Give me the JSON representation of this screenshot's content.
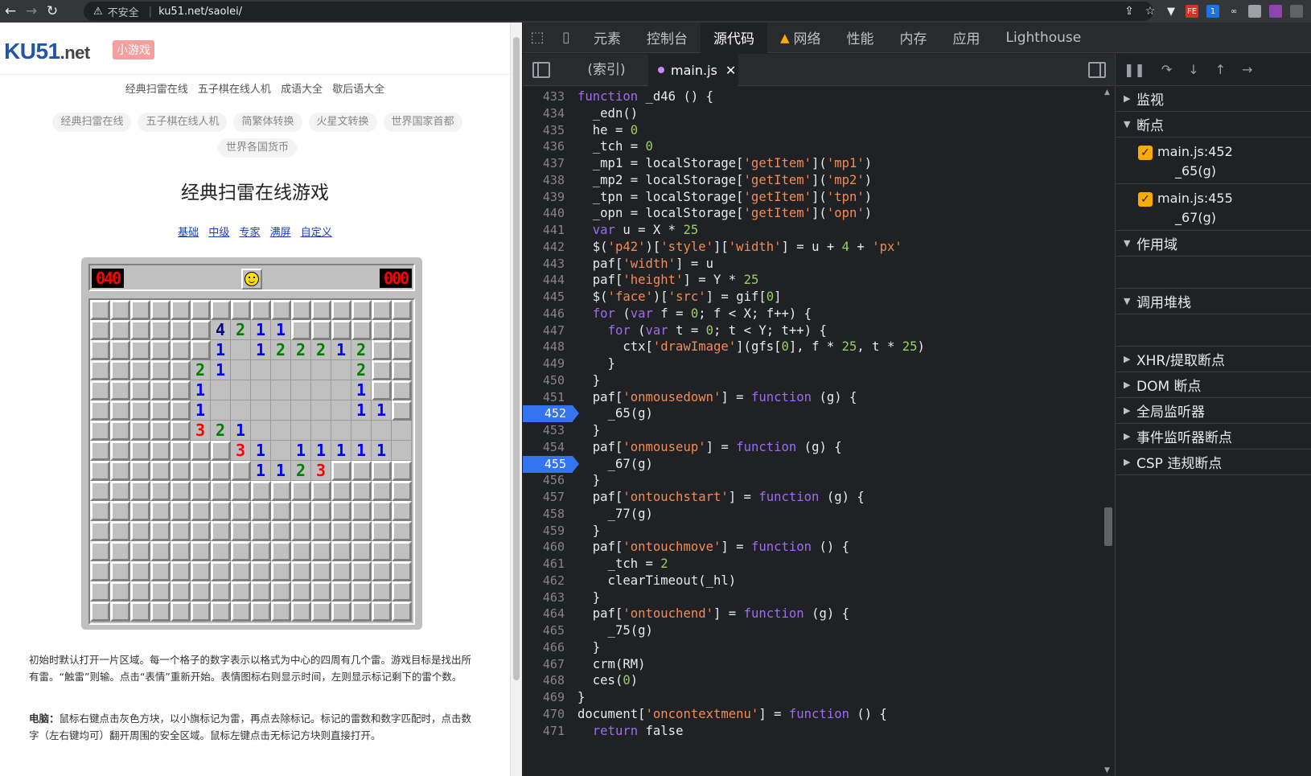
{
  "browser": {
    "security": "不安全",
    "url": "ku51.net/saolei/"
  },
  "site": {
    "logo_main": "KU51",
    "logo_net": ".net",
    "logo_badge": "小游戏",
    "top_links": [
      "经典扫雷在线",
      "五子棋在线人机",
      "成语大全",
      "歇后语大全"
    ],
    "pills": [
      "经典扫雷在线",
      "五子棋在线人机",
      "简繁体转换",
      "火星文转换",
      "世界国家首都",
      "世界各国货币"
    ],
    "title": "经典扫雷在线游戏",
    "levels": [
      "基础",
      "中级",
      "专家",
      "满屏",
      "自定义"
    ],
    "mine_counter": "040",
    "timer": "000",
    "grid": [
      "################",
      "######4211######",
      "######1 122212##",
      "#####21      2##",
      "#####1       1##",
      "#####1       11#",
      "#####321        ",
      "#######31 11111 ",
      "########1123####",
      "################",
      "################",
      "################",
      "################",
      "################",
      "################",
      "################"
    ],
    "desc1": "初始时默认打开一片区域。每一个格子的数字表示以格式为中心的四周有几个雷。游戏目标是找出所有雷。“触雷”则输。点击“表情”重新开始。表情图标右则显示时间，左则显示标记剩下的雷个数。",
    "desc2_label": "电脑：",
    "desc2": "鼠标右键点击灰色方块，以小旗标记为雷，再点去除标记。标记的雷数和数字匹配时，点击数字（左右键均可）翻开周围的安全区域。鼠标左键点击无标记方块则直接打开。"
  },
  "devtools": {
    "tabs": [
      "元素",
      "控制台",
      "源代码",
      "网络",
      "性能",
      "内存",
      "应用",
      "Lighthouse"
    ],
    "active_tab": "源代码",
    "file_tab_index": "(索引)",
    "file_tab_main": "main.js",
    "code_lines": [
      {
        "n": "433",
        "html": "<span class='kw'>function</span> _d46 () {"
      },
      {
        "n": "434",
        "html": "  _edn()"
      },
      {
        "n": "435",
        "html": "  he = <span class='num'>0</span>"
      },
      {
        "n": "436",
        "html": "  _tch = <span class='num'>0</span>"
      },
      {
        "n": "437",
        "html": "  _mp1 = localStorage[<span class='str'>'getItem'</span>](<span class='str'>'mp1'</span>)"
      },
      {
        "n": "438",
        "html": "  _mp2 = localStorage[<span class='str'>'getItem'</span>](<span class='str'>'mp2'</span>)"
      },
      {
        "n": "439",
        "html": "  _tpn = localStorage[<span class='str'>'getItem'</span>](<span class='str'>'tpn'</span>)"
      },
      {
        "n": "440",
        "html": "  _opn = localStorage[<span class='str'>'getItem'</span>](<span class='str'>'opn'</span>)"
      },
      {
        "n": "441",
        "html": "  <span class='kw'>var</span> u = X * <span class='num'>25</span>"
      },
      {
        "n": "442",
        "html": "  $(<span class='str'>'p42'</span>)[<span class='str'>'style'</span>][<span class='str'>'width'</span>] = u + <span class='num'>4</span> + <span class='str'>'px'</span>"
      },
      {
        "n": "443",
        "html": "  paf[<span class='str'>'width'</span>] = u"
      },
      {
        "n": "444",
        "html": "  paf[<span class='str'>'height'</span>] = Y * <span class='num'>25</span>"
      },
      {
        "n": "445",
        "html": "  $(<span class='str'>'face'</span>)[<span class='str'>'src'</span>] = gif[<span class='num'>0</span>]"
      },
      {
        "n": "446",
        "html": "  <span class='kw'>for</span> (<span class='kw'>var</span> f = <span class='num'>0</span>; f &lt; X; f++) {"
      },
      {
        "n": "447",
        "html": "    <span class='kw'>for</span> (<span class='kw'>var</span> t = <span class='num'>0</span>; t &lt; Y; t++) {"
      },
      {
        "n": "448",
        "html": "      ctx[<span class='str'>'drawImage'</span>](gfs[<span class='num'>0</span>], f * <span class='num'>25</span>, t * <span class='num'>25</span>)"
      },
      {
        "n": "449",
        "html": "    }"
      },
      {
        "n": "450",
        "html": "  }"
      },
      {
        "n": "451",
        "html": "  paf[<span class='str'>'onmousedown'</span>] = <span class='kw'>function</span> (g) {"
      },
      {
        "n": "452",
        "html": "    _65(g)",
        "bp": true
      },
      {
        "n": "453",
        "html": "  }"
      },
      {
        "n": "454",
        "html": "  paf[<span class='str'>'onmouseup'</span>] = <span class='kw'>function</span> (g) {"
      },
      {
        "n": "455",
        "html": "    _67(g)",
        "bp": true
      },
      {
        "n": "456",
        "html": "  }"
      },
      {
        "n": "457",
        "html": "  paf[<span class='str'>'ontouchstart'</span>] = <span class='kw'>function</span> (g) {"
      },
      {
        "n": "458",
        "html": "    _77(g)"
      },
      {
        "n": "459",
        "html": "  }"
      },
      {
        "n": "460",
        "html": "  paf[<span class='str'>'ontouchmove'</span>] = <span class='kw'>function</span> () {"
      },
      {
        "n": "461",
        "html": "    _tch = <span class='num'>2</span>"
      },
      {
        "n": "462",
        "html": "    clearTimeout(_hl)"
      },
      {
        "n": "463",
        "html": "  }"
      },
      {
        "n": "464",
        "html": "  paf[<span class='str'>'ontouchend'</span>] = <span class='kw'>function</span> (g) {"
      },
      {
        "n": "465",
        "html": "    _75(g)"
      },
      {
        "n": "466",
        "html": "  }"
      },
      {
        "n": "467",
        "html": "  crm(RM)"
      },
      {
        "n": "468",
        "html": "  ces(<span class='num'>0</span>)"
      },
      {
        "n": "469",
        "html": "}"
      },
      {
        "n": "470",
        "html": "document[<span class='str'>'oncontextmenu'</span>] = <span class='kw'>function</span> () {"
      },
      {
        "n": "471",
        "html": "  <span class='kw'>return</span> false"
      }
    ],
    "sidebar": {
      "watch": "监视",
      "breakpoints": "断点",
      "bp_items": [
        {
          "loc": "main.js:452",
          "call": "_65(g)"
        },
        {
          "loc": "main.js:455",
          "call": "_67(g)"
        }
      ],
      "scope": "作用域",
      "callstack": "调用堆栈",
      "xhr": "XHR/提取断点",
      "dom": "DOM 断点",
      "global": "全局监听器",
      "event": "事件监听器断点",
      "csp": "CSP 违规断点"
    }
  }
}
